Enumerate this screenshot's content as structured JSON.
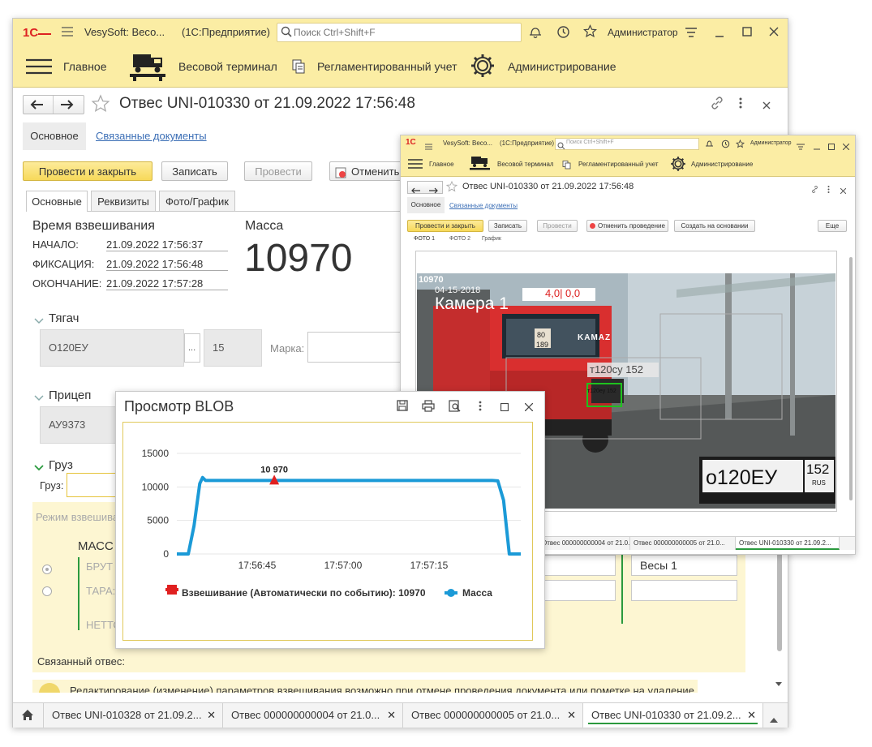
{
  "main": {
    "titlebar": {
      "logo": "1С",
      "app_title": "VesySoft: Весо...",
      "platform": "(1С:Предприятие)",
      "search_placeholder": "Поиск Ctrl+Shift+F",
      "user": "Администратор"
    },
    "sections": [
      {
        "label": "Главное",
        "icon": "menu-icon"
      },
      {
        "label": "Весовой терминал",
        "icon": "truck-scale-icon"
      },
      {
        "label": "Регламентированный учет",
        "icon": "documents-icon"
      },
      {
        "label": "Администрирование",
        "icon": "gear-icon"
      }
    ],
    "doc_title": "Отвес UNI-010330 от 21.09.2022 17:56:48",
    "subnav": {
      "basic": "Основное",
      "related": "Связанные документы"
    },
    "toolbar": {
      "post_close": "Провести и закрыть",
      "save": "Записать",
      "post": "Провести",
      "cancel": "Отменить"
    },
    "tabs": [
      "Основные",
      "Реквизиты",
      "Фото/График"
    ],
    "weighing_time": {
      "title": "Время взвешивания",
      "start_label": "НАЧАЛО:",
      "start": "21.09.2022 17:56:37",
      "fix_label": "ФИКСАЦИЯ:",
      "fix": "21.09.2022 17:56:48",
      "end_label": "ОКОНЧАНИЕ:",
      "end": "21.09.2022 17:57:28"
    },
    "mass": {
      "title": "Масса",
      "value": "10970"
    },
    "tractor": {
      "title": "Тягач",
      "plate": "О120ЕУ",
      "ellipsis": "...",
      "region": "15",
      "brand_label": "Марка:"
    },
    "trailer": {
      "title": "Прицеп",
      "plate": "АУ9373"
    },
    "cargo": {
      "title": "Груз",
      "label": "Груз:"
    },
    "mode": {
      "label": "Режим взвешива",
      "mass_title": "МАСС",
      "gross": "БРУТ",
      "tare": "ТАРА:",
      "net": "НЕТТО",
      "scales": "Весы 1"
    },
    "linked_weight": "Связанный отвес:",
    "info_text": "Редактирование (изменение) параметров взвешивания возможно при отмене проведения документа или пометке на удаление",
    "bottom_tabs": [
      "Отвес UNI-010328 от 21.09.2...",
      "Отвес 000000000004 от 21.0...",
      "Отвес 000000000005 от 21.0...",
      "Отвес UNI-010330 от 21.09.2..."
    ]
  },
  "small_window": {
    "titlebar": {
      "logo": "1С",
      "app_title": "VesySoft: Весо...",
      "platform": "(1С:Предприятие)",
      "search_placeholder": "Поиск Ctrl+Shift+F",
      "user": "Администратор"
    },
    "sections": [
      "Главное",
      "Весовой терминал",
      "Регламентированный учет",
      "Администрирование"
    ],
    "doc_title": "Отвес UNI-010330 от 21.09.2022 17:56:48",
    "subnav": {
      "basic": "Основное",
      "related": "Связанные документы"
    },
    "toolbar": {
      "post_close": "Провести и закрыть",
      "save": "Записать",
      "post": "Провести",
      "cancel_post": "Отменить проведение",
      "create_based": "Создать на основании",
      "more": "Еще"
    },
    "tabs": [
      "ФОТО 1",
      "ФОТО 2",
      "График"
    ],
    "photo": {
      "overlay_id": "10970",
      "overlay_date": "04-15-2018",
      "overlay_reading": "4,0| 0,0",
      "camera": "Камера 1",
      "truck_brand": "KAMAZ",
      "side_number": "80",
      "side_number2": "189",
      "detected": "т120су 152",
      "detected_small": "т120еу 152",
      "plate": "о120ЕУ",
      "plate_region": "152",
      "plate_country": "RUS"
    },
    "bottom_tabs": [
      "Отвес 000000000004 от 21.0...",
      "Отвес 000000000005 от 21.0...",
      "Отвес UNI-010330 от 21.09.2..."
    ]
  },
  "blob": {
    "title": "Просмотр BLOB",
    "chart_data": {
      "type": "line",
      "x": [
        "17:56:31",
        "17:56:33",
        "17:56:34",
        "17:56:35",
        "17:56:35.5",
        "17:56:36",
        "17:56:37",
        "17:56:48",
        "17:57:26",
        "17:57:27",
        "17:57:28",
        "17:57:29",
        "17:57:31"
      ],
      "x_ticks": [
        "17:56:45",
        "17:57:00",
        "17:57:15"
      ],
      "y_ticks": [
        0,
        5000,
        10000,
        15000
      ],
      "ylim": [
        0,
        15000
      ],
      "series": [
        {
          "name": "Масса",
          "color": "#1b9ad7",
          "values": [
            0,
            0,
            4200,
            10500,
            11400,
            10970,
            10970,
            10970,
            10970,
            10900,
            8000,
            0,
            0
          ]
        }
      ],
      "event": {
        "name": "Взвешивание (Автоматически по событию)",
        "value": 10970,
        "label": "10 970",
        "color": "#e02020"
      },
      "legend": [
        {
          "name": "Взвешивание (Автоматически по событию): 10970",
          "color": "#e02020"
        },
        {
          "name": "Масса",
          "color": "#1b9ad7"
        }
      ]
    }
  }
}
